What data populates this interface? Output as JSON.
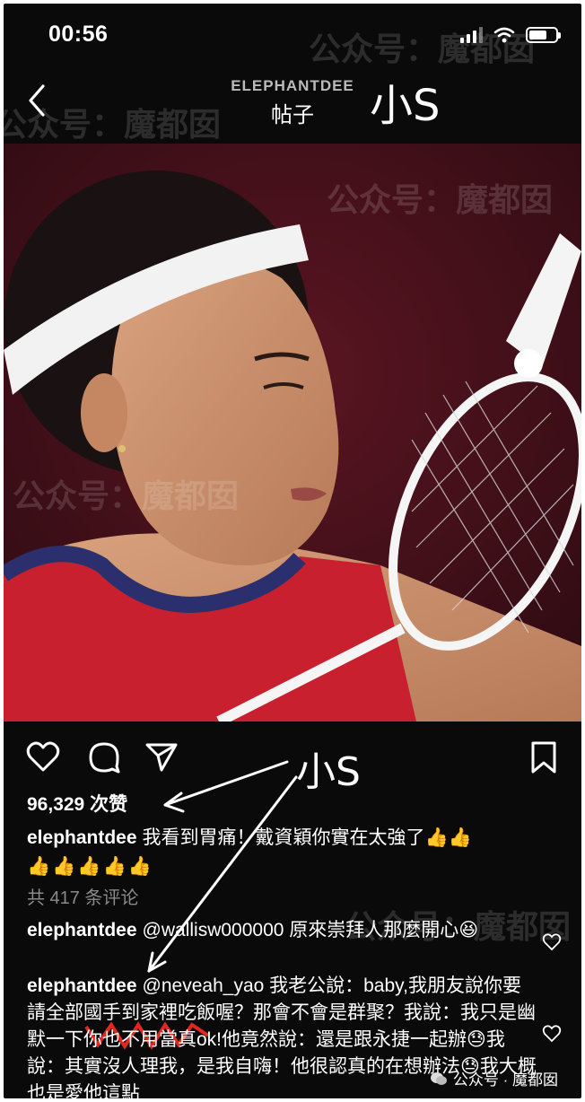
{
  "status": {
    "time": "00:56"
  },
  "nav": {
    "username": "ELEPHANTDEE",
    "subtitle": "帖子"
  },
  "annotation": {
    "label": "小S"
  },
  "post": {
    "likes": "96,329 次赞",
    "caption_user": "elephantdee",
    "caption_text": "我看到胃痛！戴資穎你實在太強了👍👍",
    "caption_emoji": "👍👍👍👍👍",
    "view_comments": "共 417 条评论"
  },
  "comments": [
    {
      "user": "elephantdee",
      "text": "@wallisw000000 原來崇拜人那麼開心😆"
    },
    {
      "user": "elephantdee",
      "text": "@neveah_yao 我老公說：baby,我朋友說你要請全部國手到家裡吃飯喔？那會不會是群聚？我說：我只是幽默一下你也不用當真ok!他竟然說：還是跟永捷一起辦😓我說：其實沒人理我，是我自嗨！他很認真的在想辦法😓我大概也是愛他這點"
    }
  ],
  "watermark": {
    "text": "公众号：魔都囡",
    "footer": "公众号 · 魔都囡"
  },
  "colors": {
    "background": "#0a0a0a",
    "jersey": "#c8202e",
    "text": "#ffffff"
  }
}
